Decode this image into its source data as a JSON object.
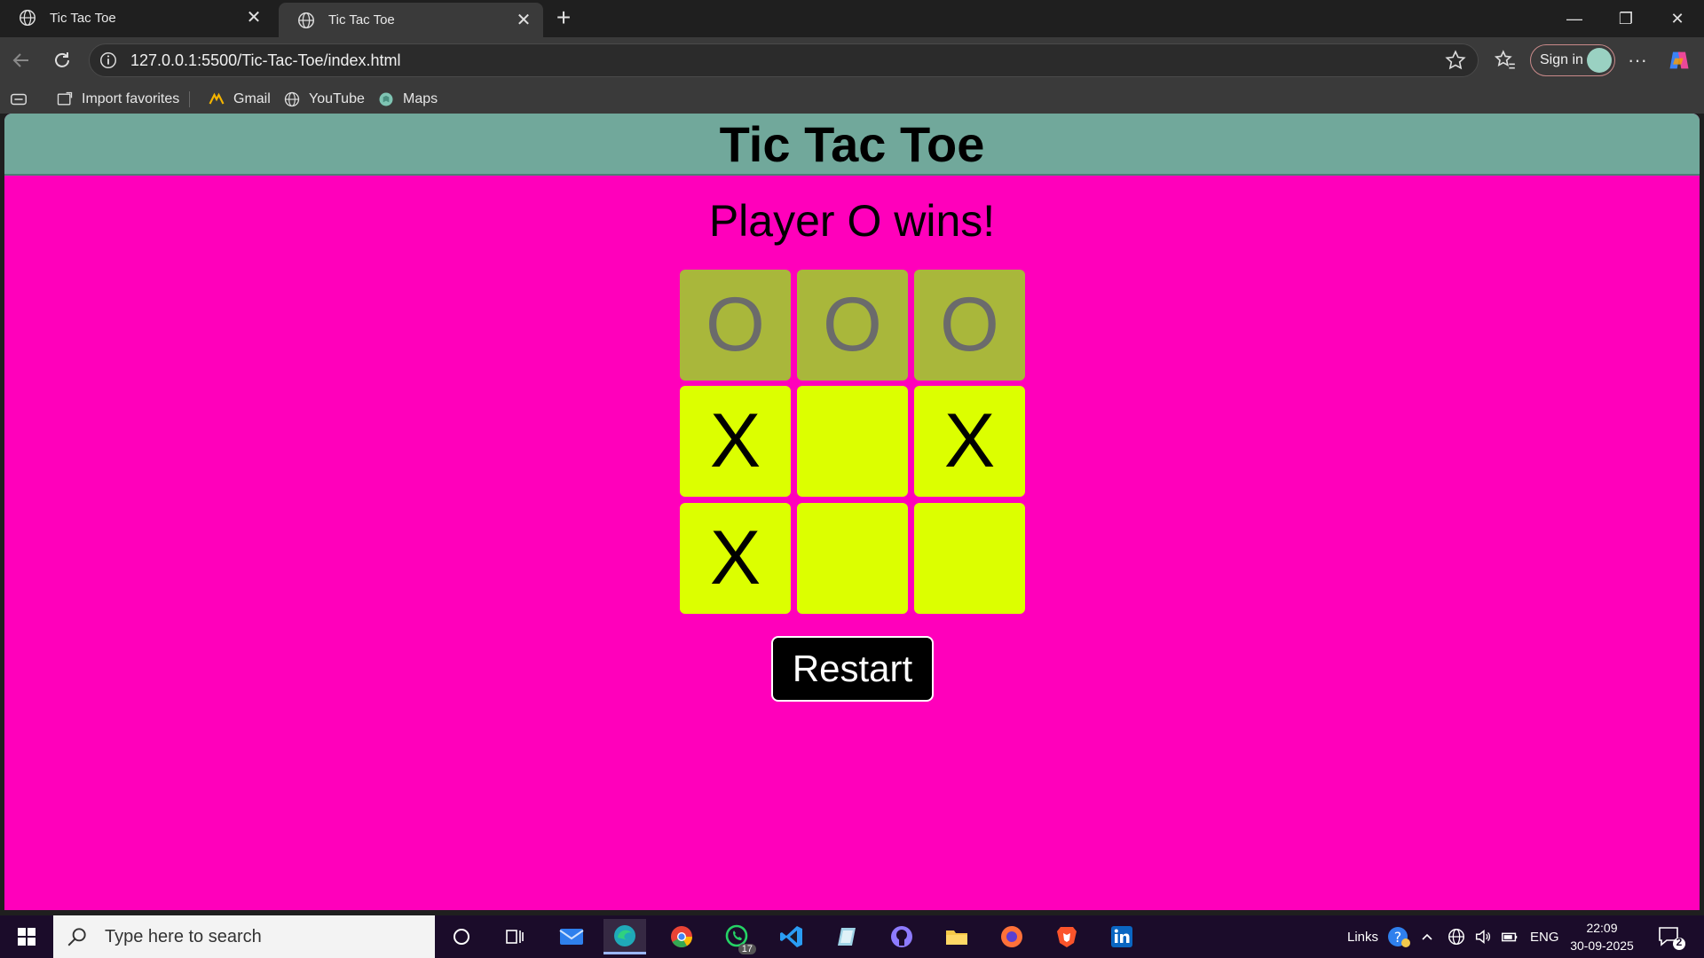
{
  "browser": {
    "tabs": [
      {
        "title": "Tic Tac Toe"
      },
      {
        "title": "Tic Tac Toe"
      }
    ],
    "url": "127.0.0.1:5500/Tic-Tac-Toe/index.html",
    "signin_label": "Sign in",
    "favorites": [
      {
        "label": "Import favorites",
        "icon": "import-icon"
      },
      {
        "label": "Gmail",
        "icon": "gmail-icon"
      },
      {
        "label": "YouTube",
        "icon": "globe-icon"
      },
      {
        "label": "Maps",
        "icon": "maps-icon"
      }
    ]
  },
  "page": {
    "title": "Tic Tac Toe",
    "status": "Player O wins!",
    "board": [
      "O",
      "O",
      "O",
      "X",
      "",
      "X",
      "X",
      "",
      ""
    ],
    "winning_cells": [
      0,
      1,
      2
    ],
    "restart_label": "Restart",
    "colors": {
      "background": "#ff00bb",
      "header": "#71a89b",
      "cell": "#dcff00",
      "winning_cell": "#a9b73b"
    }
  },
  "taskbar": {
    "search_placeholder": "Type here to search",
    "whatsapp_badge": "17",
    "links_label": "Links",
    "language": "ENG",
    "time": "22:09",
    "date": "30-09-2025",
    "notifications": "2"
  }
}
